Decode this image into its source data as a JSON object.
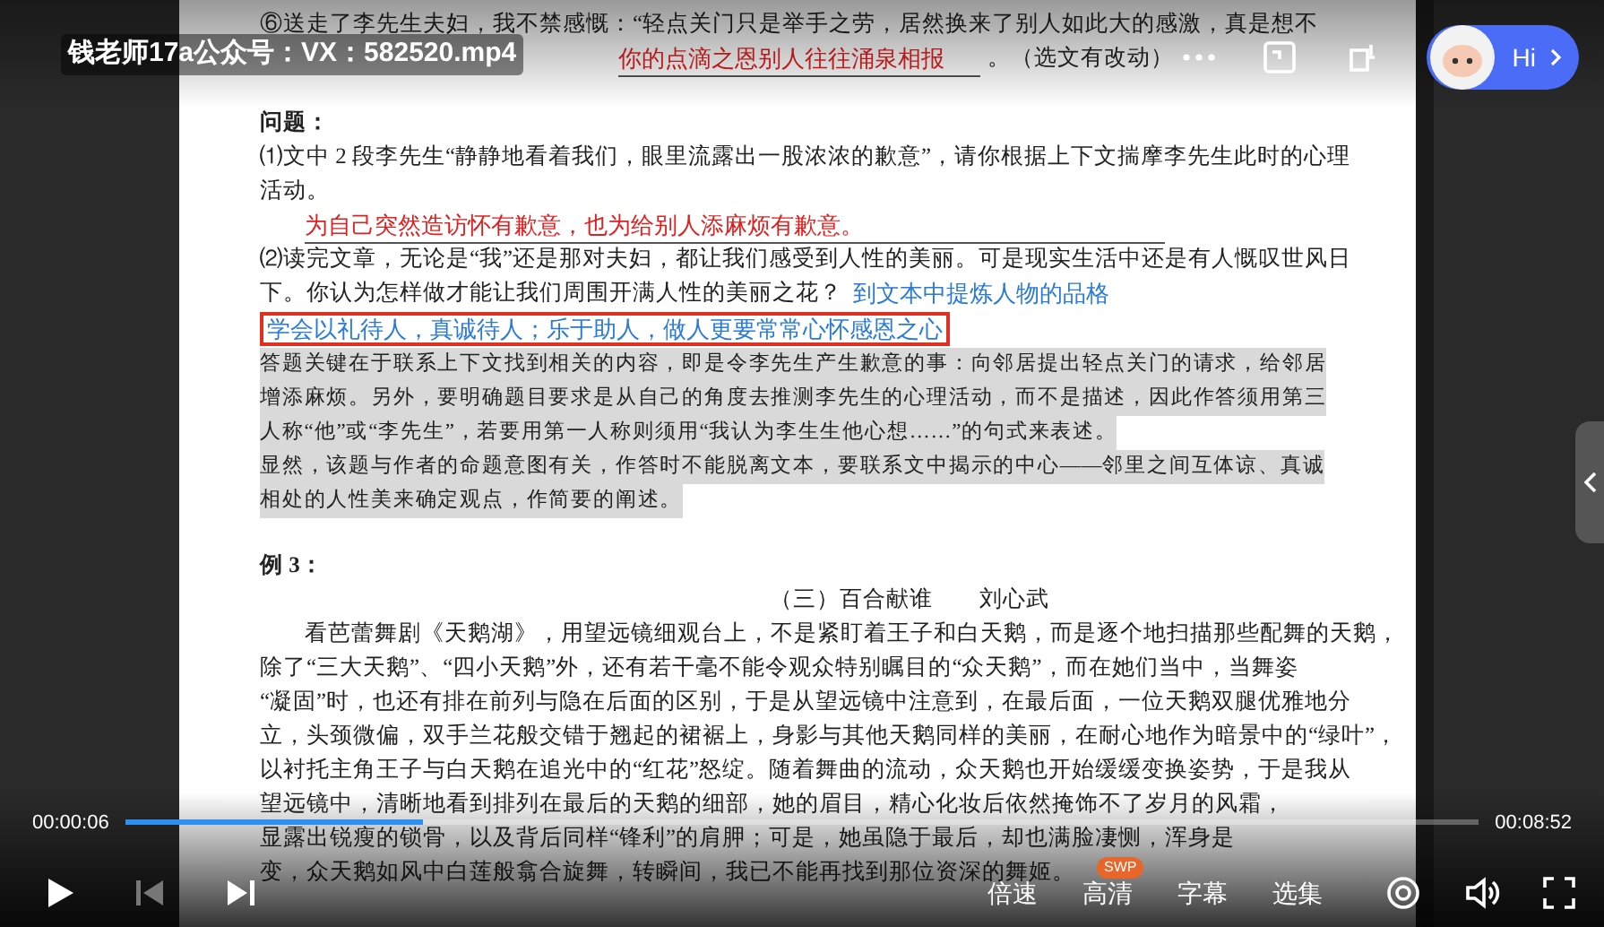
{
  "player": {
    "title": "钱老师17a公众号：VX：582520.mp4",
    "assistant_label": "Hi",
    "elapsed": "00:00:06",
    "duration": "00:08:52",
    "progress": {
      "level": 0.22
    },
    "badge": "SWP",
    "transport": [
      {
        "kind": "play",
        "disabled": false
      },
      {
        "kind": "previous",
        "disabled": true
      },
      {
        "kind": "next",
        "disabled": false
      }
    ],
    "menu": [
      "倍速",
      "高清",
      "字幕",
      "选集"
    ]
  },
  "document": {
    "lines": [
      {
        "kind": "plain",
        "text": "⑥送走了李先生夫妇，我不禁感慨：“轻点关门只是举手之劳，居然换来了别人如此大的感激，真是想不"
      },
      {
        "kind": "fill",
        "answer": "你的点滴之恩别人往往涌泉相报",
        "after": "。（选文有改动）"
      },
      {
        "kind": "gap"
      },
      {
        "kind": "heading",
        "text": "问题："
      },
      {
        "kind": "plain",
        "text": "⑴文中 2 段李先生“静静地看着我们，眼里流露出一股浓浓的歉意”，请你根据上下文揣摩李先生此时的心理"
      },
      {
        "kind": "plain",
        "text": "活动。"
      },
      {
        "kind": "answer",
        "text": "为自己突然造访怀有歉意，也为给别人添麻烦有歉意。"
      },
      {
        "kind": "plain",
        "text": "⑵读完文章，无论是“我”还是那对夫妇，都让我们感受到人性的美丽。可是现实生活中还是有人慨叹世风日"
      },
      {
        "kind": "note",
        "text": "下。你认为怎样做才能让我们周围开满人性的美丽之花？",
        "note": "到文本中提炼人物的品格"
      },
      {
        "kind": "boxed",
        "text": "学会以礼待人，真诚待人；乐于助人，做人更要常常心怀感恩之心"
      },
      {
        "kind": "shaded",
        "text": "答题关键在于联系上下文找到相关的内容，即是令李先生产生歉意的事：向邻居提出轻点关门的请求，给邻居"
      },
      {
        "kind": "shaded",
        "text": "增添麻烦。另外，要明确题目要求是从自己的角度去推测李先生的心理活动，而不是描述，因此作答须用第三"
      },
      {
        "kind": "shaded",
        "text": "人称“他”或“李先生”，若要用第一人称则须用“我认为李生生他心想……”的句式来表述。"
      },
      {
        "kind": "shaded",
        "text": "显然，该题与作者的命题意图有关，作答时不能脱离文本，要联系文中揭示的中心——邻里之间互体谅、真诚"
      },
      {
        "kind": "shaded",
        "text": "相处的人性美来确定观点，作简要的阐述。"
      },
      {
        "kind": "gap"
      },
      {
        "kind": "heading",
        "text": "例 3："
      },
      {
        "kind": "centered",
        "text": "（三）百合献谁　　刘心武"
      },
      {
        "kind": "indent",
        "text": "看芭蕾舞剧《天鹅湖》，用望远镜细观台上，不是紧盯着王子和白天鹅，而是逐个地扫描那些配舞的天鹅，"
      },
      {
        "kind": "plain",
        "text": "除了“三大天鹅”、“四小天鹅”外，还有若干毫不能令观众特别瞩目的“众天鹅”，而在她们当中，当舞姿"
      },
      {
        "kind": "plain",
        "text": "“凝固”时，也还有排在前列与隐在后面的区别，于是从望远镜中注意到，在最后面，一位天鹅双腿优雅地分"
      },
      {
        "kind": "plain",
        "text": "立，头颈微偏，双手兰花般交错于翘起的裙裾上，身影与其他天鹅同样的美丽，在耐心地作为暗景中的“绿叶”，"
      },
      {
        "kind": "plain",
        "text": "以衬托主角王子与白天鹅在追光中的“红花”怒绽。随着舞曲的流动，众天鹅也开始缓缓变换姿势，于是我从"
      },
      {
        "kind": "plain",
        "text": "望远镜中，清晰地看到排列在最后的天鹅的细部，她的眉目，精心化妆后依然掩饰不了岁月的风霜，"
      },
      {
        "kind": "plain",
        "text": "显露出锐瘦的锁骨，以及背后同样“锋利”的肩胛；可是，她虽隐于最后，却也满脸凄恻，浑身是"
      },
      {
        "kind": "plain",
        "text": "变，众天鹅如风中白莲般翕合旋舞，转瞬间，我已不能再找到那位资深的舞姬。"
      }
    ]
  }
}
